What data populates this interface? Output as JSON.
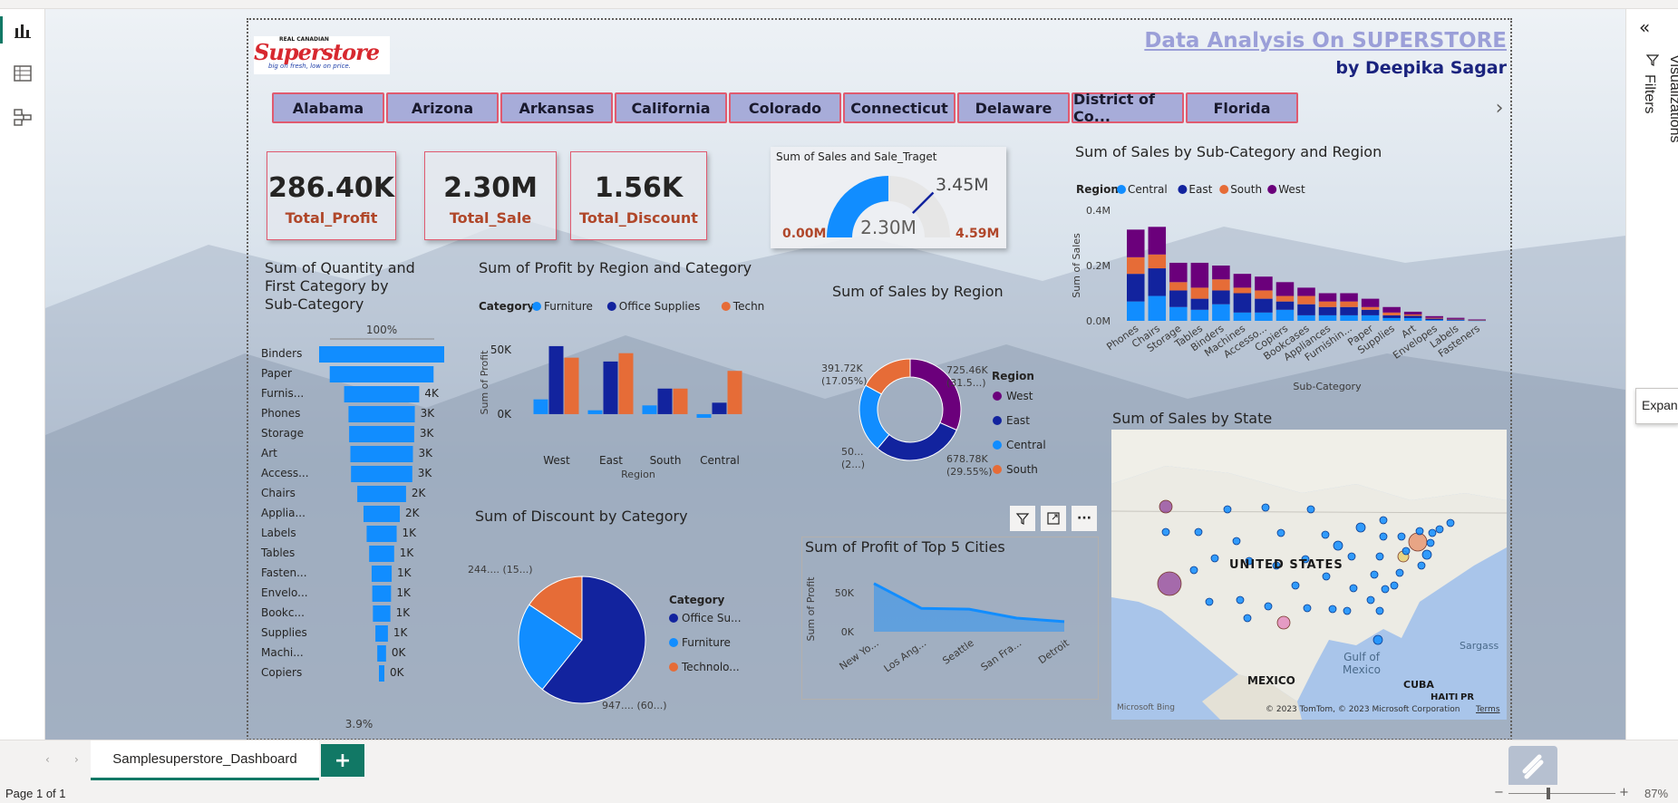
{
  "header": {
    "logo_top": "REAL CANADIAN",
    "logo_main": "Superstore",
    "logo_tag": "big on fresh, low on price.",
    "title": "Data Analysis On SUPERSTORE",
    "subtitle": "by Deepika Sagar"
  },
  "states": [
    "Alabama",
    "Arizona",
    "Arkansas",
    "California",
    "Colorado",
    "Connecticut",
    "Delaware",
    "District of Co...",
    "Florida"
  ],
  "kpis": [
    {
      "value": "286.40K",
      "label": "Total_Profit"
    },
    {
      "value": "2.30M",
      "label": "Total_Sale"
    },
    {
      "value": "1.56K",
      "label": "Total_Discount"
    }
  ],
  "gauge": {
    "title": "Sum of Sales and Sale_Traget",
    "min": "0.00M",
    "max": "4.59M",
    "value": "2.30M",
    "target": "3.45M",
    "value_fraction": 0.5,
    "target_fraction": 0.75
  },
  "funnel": {
    "title_lines": [
      "Sum of Quantity and",
      "First Category by",
      "Sub-Category"
    ],
    "top_pct": "100%",
    "bottom_pct": "3.9%",
    "rows": [
      {
        "label": "Binders",
        "value": "",
        "frac": 1.0
      },
      {
        "label": "Paper",
        "value": "",
        "frac": 0.83
      },
      {
        "label": "Furnis...",
        "value": "4K",
        "frac": 0.6
      },
      {
        "label": "Phones",
        "value": "3K",
        "frac": 0.53
      },
      {
        "label": "Storage",
        "value": "3K",
        "frac": 0.52
      },
      {
        "label": "Art",
        "value": "3K",
        "frac": 0.5
      },
      {
        "label": "Access...",
        "value": "3K",
        "frac": 0.49
      },
      {
        "label": "Chairs",
        "value": "2K",
        "frac": 0.39
      },
      {
        "label": "Applia...",
        "value": "2K",
        "frac": 0.29
      },
      {
        "label": "Labels",
        "value": "1K",
        "frac": 0.24
      },
      {
        "label": "Tables",
        "value": "1K",
        "frac": 0.2
      },
      {
        "label": "Fasten...",
        "value": "1K",
        "frac": 0.16
      },
      {
        "label": "Envelo...",
        "value": "1K",
        "frac": 0.15
      },
      {
        "label": "Bookc...",
        "value": "1K",
        "frac": 0.14
      },
      {
        "label": "Supplies",
        "value": "1K",
        "frac": 0.1
      },
      {
        "label": "Machi...",
        "value": "0K",
        "frac": 0.07
      },
      {
        "label": "Copiers",
        "value": "0K",
        "frac": 0.04
      }
    ]
  },
  "charts": {
    "profit_region": "Sum of Profit by Region and Category",
    "sales_region": "Sum of Sales by Region",
    "subcat_region": "Sum of Sales by Sub-Category and Region",
    "sales_state": "Sum of Sales by State",
    "discount_cat": "Sum of Discount by Category",
    "top_cities": "Sum of Profit of Top 5 Cities"
  },
  "chart_data": [
    {
      "type": "bar",
      "title": "Sum of Profit by Region and Category",
      "legend_title": "Category",
      "categories": [
        "West",
        "East",
        "South",
        "Central"
      ],
      "xlabel": "Region",
      "ylabel": "Sum of Profit",
      "yticks": [
        "50K",
        "0K"
      ],
      "ylim": [
        -5000,
        60000
      ],
      "series": [
        {
          "name": "Furniture",
          "color": "#118dff",
          "values": [
            11500,
            3000,
            6800,
            -2900
          ]
        },
        {
          "name": "Office Supplies",
          "color": "#12239e",
          "values": [
            53000,
            41000,
            19900,
            8900
          ]
        },
        {
          "name": "Technology",
          "color": "#e66c37",
          "values": [
            44000,
            47500,
            19900,
            33700
          ]
        }
      ]
    },
    {
      "type": "pie",
      "title": "Sum of Sales by Region",
      "legend_title": "Region",
      "slices": [
        {
          "name": "West",
          "value": 725460,
          "color": "#6b007b",
          "label": "725.46K",
          "pct": "(31.5...)"
        },
        {
          "name": "East",
          "value": 678780,
          "color": "#12239e",
          "label": "678.78K",
          "pct": "(29.55%)"
        },
        {
          "name": "Central",
          "value": 501240,
          "color": "#118dff",
          "label": "50...",
          "pct": "(2...)"
        },
        {
          "name": "South",
          "value": 391720,
          "color": "#e66c37",
          "label": "391.72K",
          "pct": "(17.05%)"
        }
      ]
    },
    {
      "type": "bar",
      "title": "Sum of Sales by Sub-Category and Region",
      "legend_title": "Region",
      "xlabel": "Sub-Category",
      "ylabel": "Sum of Sales",
      "yticks": [
        "0.4M",
        "0.2M",
        "0.0M"
      ],
      "ylim": [
        0,
        0.4
      ],
      "categories": [
        "Phones",
        "Chairs",
        "Storage",
        "Tables",
        "Binders",
        "Machines",
        "Accesso...",
        "Copiers",
        "Bookcases",
        "Appliances",
        "Furnishin...",
        "Paper",
        "Supplies",
        "Art",
        "Envelopes",
        "Labels",
        "Fasteners"
      ],
      "series": [
        {
          "name": "Central",
          "color": "#118dff",
          "values": [
            0.07,
            0.09,
            0.05,
            0.04,
            0.06,
            0.03,
            0.03,
            0.04,
            0.02,
            0.02,
            0.02,
            0.02,
            0.01,
            0.01,
            0.003,
            0.002,
            0.001
          ]
        },
        {
          "name": "East",
          "color": "#12239e",
          "values": [
            0.1,
            0.1,
            0.06,
            0.04,
            0.05,
            0.07,
            0.05,
            0.03,
            0.04,
            0.03,
            0.03,
            0.02,
            0.01,
            0.008,
            0.005,
            0.003,
            0.001
          ]
        },
        {
          "name": "South",
          "color": "#e66c37",
          "values": [
            0.06,
            0.05,
            0.03,
            0.04,
            0.04,
            0.02,
            0.03,
            0.02,
            0.03,
            0.02,
            0.02,
            0.01,
            0.01,
            0.005,
            0.003,
            0.002,
            0.001
          ]
        },
        {
          "name": "West",
          "color": "#6b007b",
          "values": [
            0.1,
            0.1,
            0.07,
            0.09,
            0.05,
            0.05,
            0.05,
            0.05,
            0.03,
            0.03,
            0.03,
            0.03,
            0.02,
            0.01,
            0.006,
            0.004,
            0.002
          ]
        }
      ]
    },
    {
      "type": "pie",
      "title": "Sum of Discount by Category",
      "legend_title": "Category",
      "slices": [
        {
          "name": "Office Su...",
          "value": 947,
          "color": "#12239e",
          "label": "947.... (60...)"
        },
        {
          "name": "Furniture",
          "value": 368,
          "color": "#118dff",
          "label": ""
        },
        {
          "name": "Technolo...",
          "value": 244,
          "color": "#e66c37",
          "label": "244.... (15...)"
        }
      ]
    },
    {
      "type": "area",
      "title": "Sum of Profit of Top 5 Cities",
      "ylabel": "Sum of Profit",
      "yticks": [
        "50K",
        "0K"
      ],
      "ylim": [
        0,
        70000
      ],
      "categories": [
        "New Yo...",
        "Los Ang...",
        "Seattle",
        "San Fra...",
        "Detroit"
      ],
      "values": [
        62000,
        30000,
        29000,
        17500,
        13000
      ]
    }
  ],
  "map": {
    "labels": [
      "UNITED STATES",
      "Gulf of Mexico",
      "MEXICO",
      "CUBA",
      "HAITI",
      "PR",
      "Sargass"
    ],
    "attribution": "© 2023 TomTom, © 2023 Microsoft Corporation",
    "terms": "Terms",
    "brand": "Microsoft Bing"
  },
  "visual_header_icons": [
    "filter-icon",
    "focus-mode-icon",
    "more-options-icon"
  ],
  "right_pane": {
    "filters": "Filters",
    "visualizations": "Visualizations",
    "expand_tip": "Expan"
  },
  "bottom": {
    "tab": "Samplesuperstore_Dashboard",
    "add": "+",
    "page": "Page 1 of 1",
    "zoom": "87%"
  }
}
